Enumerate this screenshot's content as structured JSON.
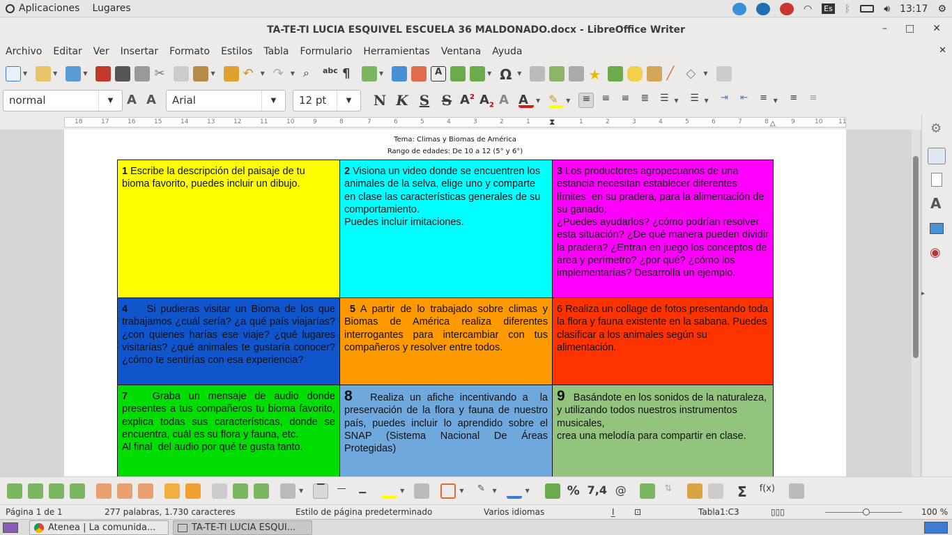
{
  "topbar": {
    "apps_label": "Aplicaciones",
    "places_label": "Lugares",
    "keyboard_layout": "Es",
    "clock": "13:17"
  },
  "window": {
    "title": "TA-TE-TI  LUCIA ESQUIVEL ESCUELA 36 MALDONADO.docx - LibreOffice Writer"
  },
  "menubar": {
    "items": [
      "Archivo",
      "Editar",
      "Ver",
      "Insertar",
      "Formato",
      "Estilos",
      "Tabla",
      "Formulario",
      "Herramientas",
      "Ventana",
      "Ayuda"
    ]
  },
  "format": {
    "paragraph_style": "normal",
    "font_name": "Arial",
    "font_size": "12 pt",
    "bold_label": "N",
    "italic_label": "K",
    "underline_label": "S",
    "strike_label": "S"
  },
  "ruler": {
    "left_ticks": [
      "18",
      "17",
      "16",
      "15",
      "14",
      "13",
      "12",
      "11",
      "10",
      "9",
      "8"
    ],
    "right_ticks": [
      "7",
      "6",
      "5",
      "4",
      "3",
      "2",
      "1",
      "1",
      "2",
      "3",
      "4",
      "5",
      "6",
      "7",
      "8",
      "9",
      "10",
      "11"
    ]
  },
  "document": {
    "header_line1": "Tema: Climas y Biomas de América",
    "header_line2": "Rango de edades: De  10 a 12  (5° y 6°)",
    "cells": [
      {
        "num": "1",
        "text": " Escribe la descripción del paisaje de tu bioma favorito, puedes incluir un dibujo.",
        "bg": "#ffff00"
      },
      {
        "num": "2",
        "text": " Visiona un video donde se encuentren los animales de la selva, elige uno y comparte en clase las características generales de su comportamiento.\nPuedes incluir imitaciones.",
        "bg": "#00ffff"
      },
      {
        "num": "3",
        "text": " Los productores agropecuarios de una estancia necesitan establecer diferentes límites  en su pradera, para la alimentación de su ganado.\n¿Puedes ayudarlos? ¿cómo podrían resolver esta situación? ¿De qué manera pueden dividir la pradera? ¿Entran en juego los conceptos de área y perímetro? ¿por qué? ¿cómo los implementarías? Desarrolla un ejemplo.",
        "bg": "#ff00ff"
      },
      {
        "num": "4",
        "text": "    Si pudieras visitar un Bioma de los que trabajamos ¿cuál sería? ¿a qué país viajarías? ¿con quienes harías ese viaje? ¿qué lugares visitarías? ¿qué animales te gustaría conocer? ¿cómo te sentirías con esa experiencia?",
        "bg": "#1155cc"
      },
      {
        "num": " 5",
        "text": " A partir de lo trabajado sobre climas y Biomas de América realiza diferentes interrogantes para intercambiar con tus compañeros y resolver entre todos.",
        "bg": "#ff9900"
      },
      {
        "num": "6",
        "text": " Realiza un collage de fotos presentando toda la flora y fauna existente en la sabana. Puedes clasificar a los animales según su alimentación.",
        "bg": "#ff3300"
      },
      {
        "num": "7",
        "text": "   Graba un mensaje de audio donde presentes a tus compañeros tu bioma favorito, explica todas sus características, donde se encuentra, cuál es su flora y fauna, etc.\nAl final  del audio por qué te gusta tanto.",
        "bg": "#00dd00"
      },
      {
        "num": "8",
        "text": "   Realiza un afiche incentivando a  la preservación de la flora y fauna de nuestro país, puedes incluir lo aprendido sobre el SNAP (Sistema Nacional De Áreas Protegidas)",
        "bg": "#6fa8dc"
      },
      {
        "num": "9",
        "text": "   Basándote en los sonidos de la naturaleza, y utilizando todos nuestros instrumentos musicales,\ncrea una melodía para compartir en clase.",
        "bg": "#93c47d"
      }
    ]
  },
  "table_toolbar": {
    "percent_label": "%",
    "number_label": "7,4",
    "sum_label": "Σ",
    "formula_label": "f(x)"
  },
  "status": {
    "page": "Página 1 de 1",
    "words": "277 palabras, 1.730 caracteres",
    "page_style": "Estilo de página predeterminado",
    "language": "Varios idiomas",
    "cell": "Tabla1:C3",
    "zoom": "100 %"
  },
  "taskbar": {
    "task1": "Atenea | La comunida...",
    "task2": "TA-TE-TI  LUCIA ESQUI..."
  },
  "colors": {
    "cell1": "#ffff00",
    "cell2": "#00ffff",
    "cell3": "#ff00ff",
    "cell4": "#1155cc",
    "cell5": "#ff9900",
    "cell6": "#ff3300",
    "cell7": "#00dd00",
    "cell8": "#6fa8dc",
    "cell9": "#93c47d"
  }
}
